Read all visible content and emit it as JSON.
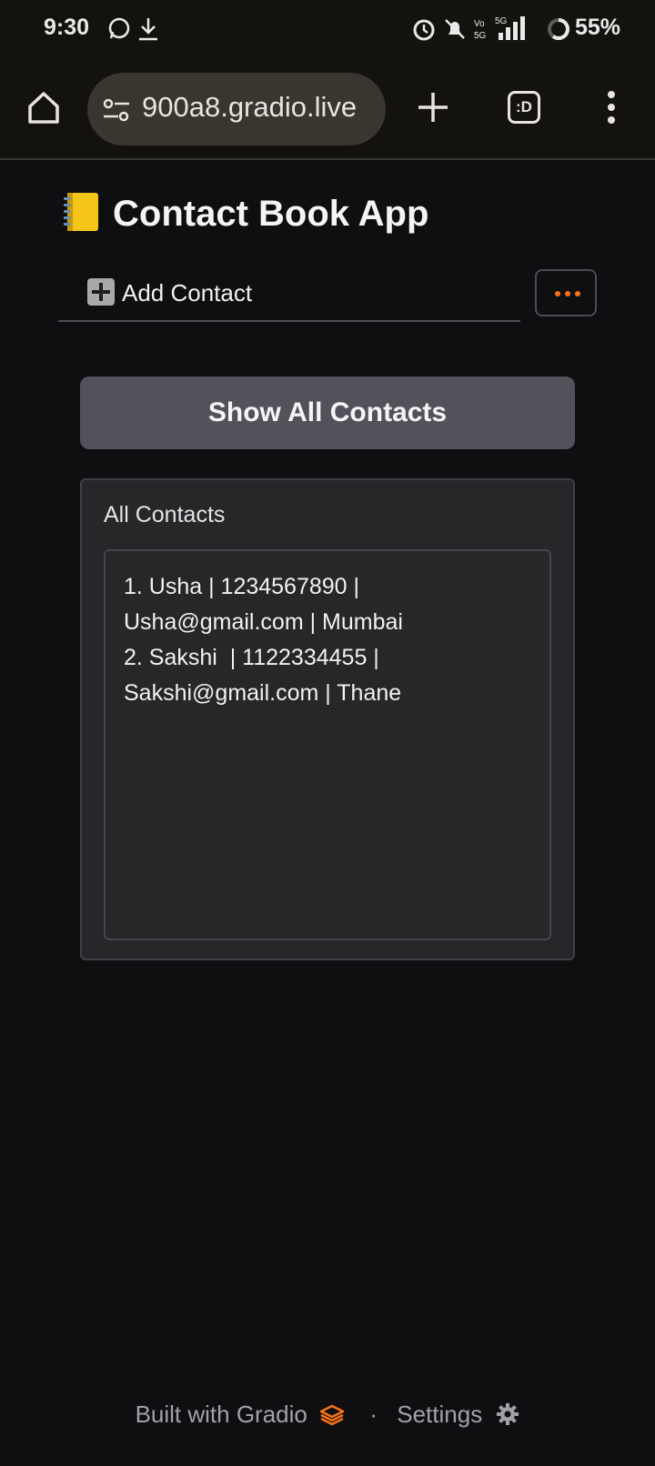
{
  "status_bar": {
    "time": "9:30",
    "battery": "55%",
    "network": "5G"
  },
  "browser": {
    "url": "900a8.gradio.live",
    "tabs_label": ":D"
  },
  "app": {
    "title": "Contact Book App",
    "tab_label": "Add Contact",
    "show_button": "Show All Contacts",
    "output_label": "All Contacts",
    "output_value": "1. Usha | 1234567890 |\nUsha@gmail.com | Mumbai\n2. Sakshi  | 1122334455 |\nSakshi@gmail.com | Thane"
  },
  "footer": {
    "built_with": "Built with Gradio",
    "separator": "·",
    "settings": "Settings"
  },
  "colors": {
    "accent_orange": "#f97316",
    "button_bg": "#52525b",
    "panel_bg": "#27272a"
  }
}
